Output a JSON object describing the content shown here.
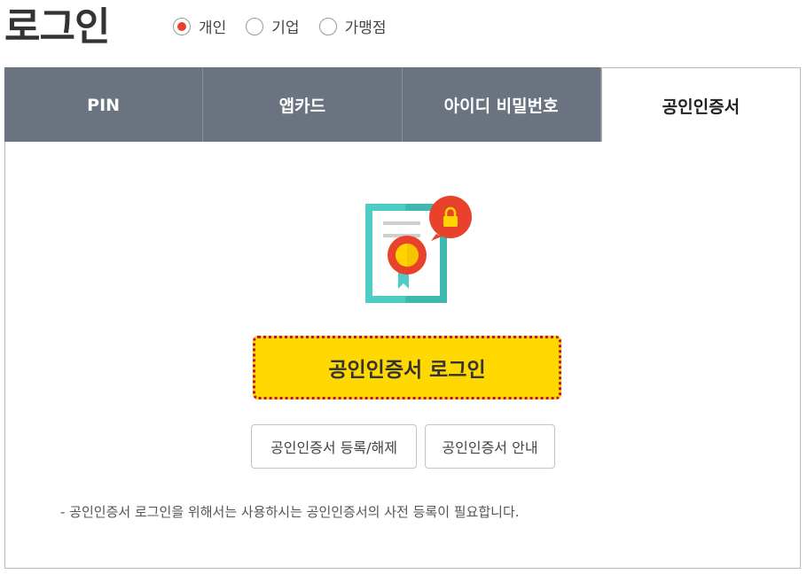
{
  "page_title": "로그인",
  "user_type": {
    "options": [
      {
        "label": "개인",
        "selected": true
      },
      {
        "label": "기업",
        "selected": false
      },
      {
        "label": "가맹점",
        "selected": false
      }
    ],
    "selected_color": "#e8412c"
  },
  "tabs": [
    {
      "label": "PIN",
      "active": false
    },
    {
      "label": "앱카드",
      "active": false
    },
    {
      "label": "아이디 비밀번호",
      "active": false
    },
    {
      "label": "공인인증서",
      "active": true
    }
  ],
  "cert_panel": {
    "icon": "certificate-lock-icon",
    "login_button": "공인인증서 로그인",
    "register_button": "공인인증서 등록/해제",
    "guide_button": "공인인증서 안내",
    "notice": "- 공인인증서 로그인을 위해서는 사용하시는 공인인증서의 사전 등록이 필요합니다."
  },
  "colors": {
    "tab_bg": "#6b7280",
    "login_button_bg": "#ffd800",
    "focus_outline": "#c8102e"
  }
}
